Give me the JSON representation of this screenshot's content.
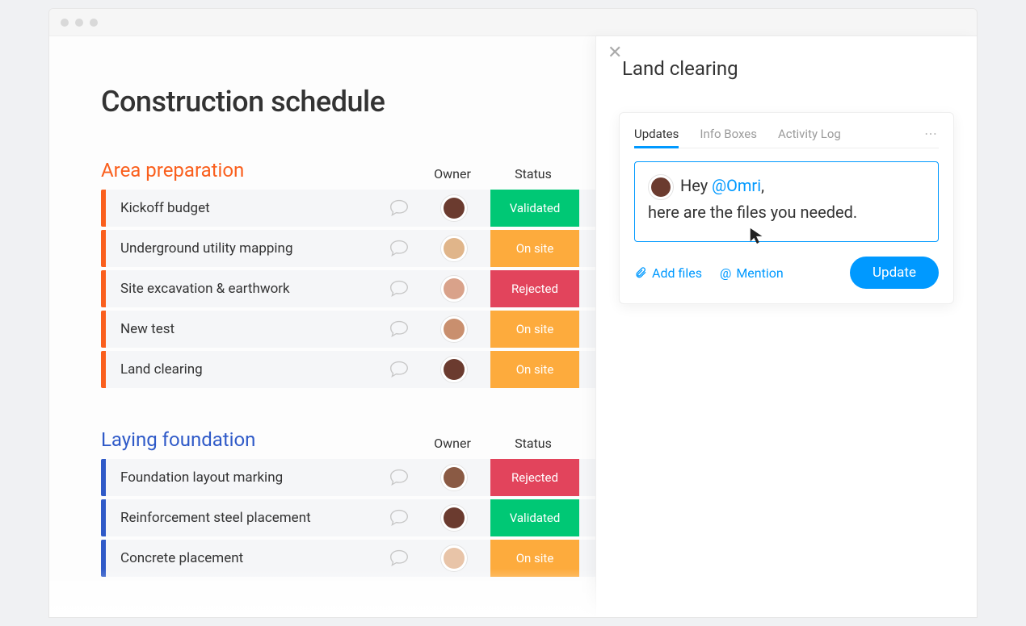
{
  "page": {
    "title": "Construction schedule"
  },
  "columns": {
    "owner": "Owner",
    "status": "Status"
  },
  "status_colors": {
    "Validated": "status-green",
    "On site": "status-orange",
    "Rejected": "status-red"
  },
  "avatar_colors": {
    "a1": "#6b3b2f",
    "a2": "#e0b58a",
    "a3": "#d9a28a",
    "a4": "#c98f6e",
    "a5": "#8a5a44",
    "a6": "#e8c4a8"
  },
  "groups": [
    {
      "title": "Area preparation",
      "color": "orange",
      "tasks": [
        {
          "name": "Kickoff budget",
          "status": "Validated",
          "avatar": "a1"
        },
        {
          "name": "Underground utility mapping",
          "status": "On site",
          "avatar": "a2"
        },
        {
          "name": "Site excavation & earthwork",
          "status": "Rejected",
          "avatar": "a3"
        },
        {
          "name": "New test",
          "status": "On site",
          "avatar": "a4"
        },
        {
          "name": "Land clearing",
          "status": "On site",
          "avatar": "a1"
        }
      ]
    },
    {
      "title": "Laying foundation",
      "color": "blue",
      "tasks": [
        {
          "name": "Foundation layout marking",
          "status": "Rejected",
          "avatar": "a5"
        },
        {
          "name": "Reinforcement steel placement",
          "status": "Validated",
          "avatar": "a1"
        },
        {
          "name": "Concrete placement",
          "status": "On site",
          "avatar": "a6"
        }
      ]
    }
  ],
  "panel": {
    "title": "Land clearing",
    "tabs": {
      "updates": "Updates",
      "info": "Info Boxes",
      "activity": "Activity Log"
    },
    "compose": {
      "avatar": "a1",
      "prefix": "Hey ",
      "mention": "@Omri",
      "suffix": ",",
      "line2": "here are the files you needed."
    },
    "actions": {
      "add_files": "Add files",
      "mention": "Mention",
      "update": "Update"
    }
  }
}
